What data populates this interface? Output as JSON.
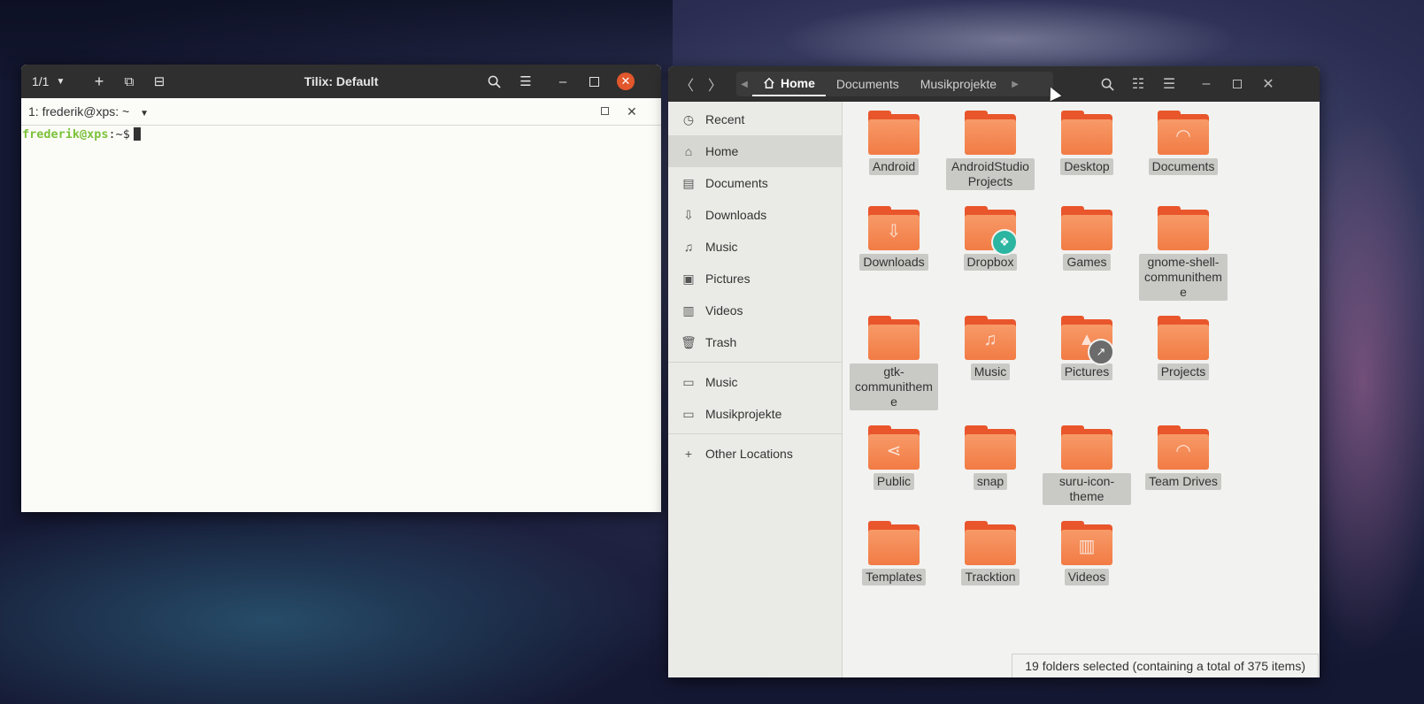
{
  "terminal": {
    "tab_counter": "1/1",
    "title": "Tilix: Default",
    "session_label": "1: frederik@xps: ~",
    "prompt_user": "frederik@xps",
    "prompt_path": ":~$"
  },
  "files": {
    "pathbar": {
      "crumbs": [
        "Home",
        "Documents",
        "Musikprojekte"
      ]
    },
    "sidebar": {
      "items": [
        {
          "label": "Recent",
          "icon": "clock-icon"
        },
        {
          "label": "Home",
          "icon": "home-icon"
        },
        {
          "label": "Documents",
          "icon": "document-icon"
        },
        {
          "label": "Downloads",
          "icon": "download-icon"
        },
        {
          "label": "Music",
          "icon": "music-icon"
        },
        {
          "label": "Pictures",
          "icon": "picture-icon"
        },
        {
          "label": "Videos",
          "icon": "video-icon"
        },
        {
          "label": "Trash",
          "icon": "trash-icon"
        }
      ],
      "bookmarks": [
        {
          "label": "Music",
          "icon": "folder-icon"
        },
        {
          "label": "Musikprojekte",
          "icon": "folder-icon"
        }
      ],
      "other": {
        "label": "Other Locations",
        "icon": "plus-icon"
      }
    },
    "folders": [
      {
        "label": "Android"
      },
      {
        "label": "AndroidStudioProjects"
      },
      {
        "label": "Desktop"
      },
      {
        "label": "Documents"
      },
      {
        "label": "Downloads"
      },
      {
        "label": "Dropbox"
      },
      {
        "label": "Games"
      },
      {
        "label": "gnome-shell-communitheme"
      },
      {
        "label": "gtk-communitheme"
      },
      {
        "label": "Music"
      },
      {
        "label": "Pictures"
      },
      {
        "label": "Projects"
      },
      {
        "label": "Public"
      },
      {
        "label": "snap"
      },
      {
        "label": "suru-icon-theme"
      },
      {
        "label": "Team Drives"
      },
      {
        "label": "Templates"
      },
      {
        "label": "Tracktion"
      },
      {
        "label": "Videos"
      }
    ],
    "status": "19 folders selected  (containing a total of 375 items)"
  },
  "colors": {
    "folder_accent": "#e9562c",
    "close_button": "#e2572c",
    "prompt_green": "#7cc23a",
    "prompt_blue": "#4a7fd6"
  }
}
